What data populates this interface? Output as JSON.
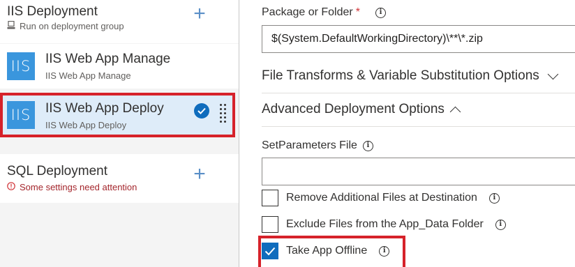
{
  "left": {
    "phases": [
      {
        "title": "IIS Deployment",
        "subtitle": "Run on deployment group",
        "subtitle_icon": "deployment-group-icon"
      },
      {
        "title": "SQL Deployment",
        "subtitle": "Some settings need attention",
        "subtitle_icon": "error-icon"
      }
    ],
    "tasks": [
      {
        "icon_text": "IIS",
        "name": "IIS Web App Manage",
        "subtitle": "IIS Web App Manage",
        "selected": false
      },
      {
        "icon_text": "IIS",
        "name": "IIS Web App Deploy",
        "subtitle": "IIS Web App Deploy",
        "selected": true
      }
    ],
    "add_symbol": "+"
  },
  "right": {
    "package": {
      "label": "Package or Folder",
      "required_mark": "*",
      "value": "$(System.DefaultWorkingDirectory)\\**\\*.zip"
    },
    "sections": {
      "file_transforms": "File Transforms & Variable Substitution Options",
      "advanced": "Advanced Deployment Options"
    },
    "setparameters": {
      "label": "SetParameters File",
      "value": ""
    },
    "checkboxes": [
      {
        "label": "Remove Additional Files at Destination",
        "checked": false
      },
      {
        "label": "Exclude Files from the App_Data Folder",
        "checked": false
      },
      {
        "label": "Take App Offline",
        "checked": true
      }
    ]
  },
  "colors": {
    "accent": "#0f6cbd",
    "highlight": "#d6222a",
    "iis_tile": "#3a96dd",
    "error": "#d13438"
  }
}
